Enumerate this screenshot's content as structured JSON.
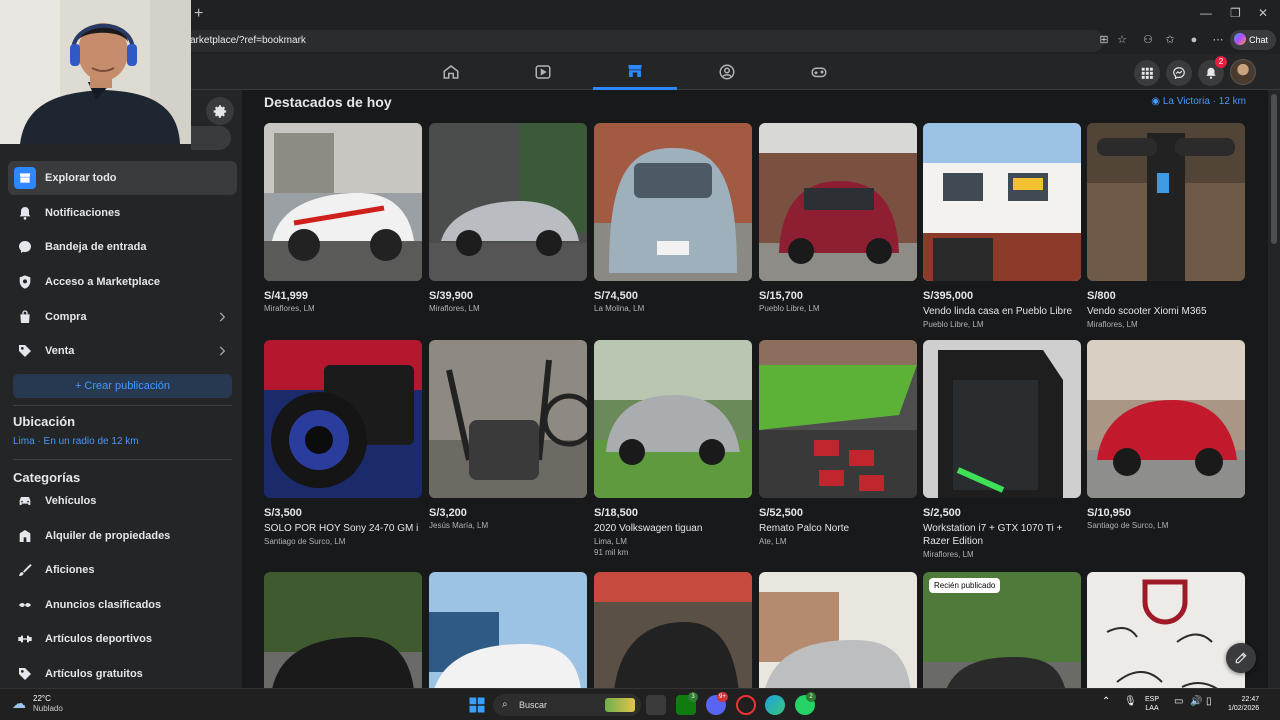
{
  "browser": {
    "url": "arketplace/?ref=bookmark",
    "chat_label": "Chat"
  },
  "nav": {
    "notifications_count": "2",
    "tabs": [
      "home",
      "video",
      "marketplace",
      "groups",
      "gaming"
    ]
  },
  "sidebar": {
    "items": [
      {
        "label": "Explorar todo"
      },
      {
        "label": "Notificaciones"
      },
      {
        "label": "Bandeja de entrada"
      },
      {
        "label": "Acceso a Marketplace"
      },
      {
        "label": "Compra"
      },
      {
        "label": "Venta"
      }
    ],
    "create_button": "+ Crear publicación",
    "location_heading": "Ubicación",
    "location_value": "Lima · En un radio de 12 km",
    "categories_heading": "Categorías",
    "categories": [
      {
        "label": "Vehículos"
      },
      {
        "label": "Alquiler de propiedades"
      },
      {
        "label": "Aficiones"
      },
      {
        "label": "Anuncios clasificados"
      },
      {
        "label": "Artículos deportivos"
      },
      {
        "label": "Artículos gratuitos"
      }
    ]
  },
  "main": {
    "section_title": "Destacados de hoy",
    "location_link": "La Victoria · 12 km",
    "new_badge": "Recién publicado",
    "listings": [
      {
        "price": "S/41,999",
        "title": "",
        "location": "Miraflores, LM",
        "extra": ""
      },
      {
        "price": "S/39,900",
        "title": "",
        "location": "Miraflores, LM",
        "extra": ""
      },
      {
        "price": "S/74,500",
        "title": "",
        "location": "La Molina, LM",
        "extra": ""
      },
      {
        "price": "S/15,700",
        "title": "",
        "location": "Pueblo Libre, LM",
        "extra": ""
      },
      {
        "price": "S/395,000",
        "title": "Vendo linda casa en Pueblo Libre",
        "location": "Pueblo Libre, LM",
        "extra": ""
      },
      {
        "price": "S/800",
        "title": "Vendo scooter Xiomi M365",
        "location": "Miraflores, LM",
        "extra": ""
      },
      {
        "price": "S/3,500",
        "title": "SOLO POR HOY Sony 24-70 GM i",
        "location": "Santiago de Surco, LM",
        "extra": ""
      },
      {
        "price": "S/3,200",
        "title": "",
        "location": "Jesús María, LM",
        "extra": ""
      },
      {
        "price": "S/18,500",
        "title": "2020 Volkswagen tiguan",
        "location": "Lima, LM",
        "extra": "91 mil km"
      },
      {
        "price": "S/52,500",
        "title": "Remato Palco Norte",
        "location": "Ate, LM",
        "extra": ""
      },
      {
        "price": "S/2,500",
        "title": "Workstation i7 + GTX 1070 Ti + Razer Edition",
        "location": "Miraflores, LM",
        "extra": ""
      },
      {
        "price": "S/10,950",
        "title": "",
        "location": "Santiago de Surco, LM",
        "extra": ""
      }
    ]
  },
  "taskbar": {
    "temperature": "22°C",
    "condition": "Nublado",
    "search_placeholder": "Buscar",
    "lang_line1": "ESP",
    "lang_line2": "LAA",
    "time": "22:47",
    "date": "1/02/2026",
    "badges": [
      "3",
      "9+",
      "2"
    ]
  },
  "colors": {
    "accent": "#2d88ff",
    "link": "#4599ff",
    "background": "#18191a",
    "surface": "#242526"
  }
}
